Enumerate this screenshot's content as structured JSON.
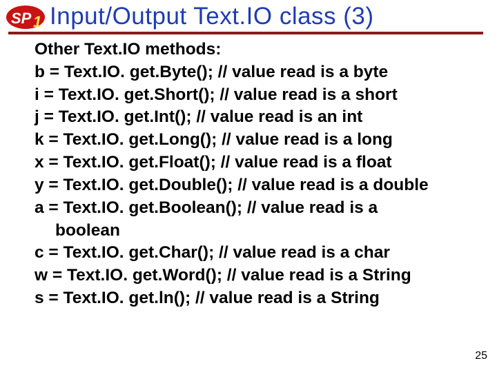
{
  "logo": {
    "text_main": "SP",
    "text_sub": "1"
  },
  "title": "Input/Output Text.IO class (3)",
  "lead": "Other Text.IO  methods:",
  "lines": [
    "b = Text.IO. get.Byte(); // value read is a byte",
    "i = Text.IO. get.Short(); // value read is a short",
    "j = Text.IO. get.Int(); // value read is an int",
    "k = Text.IO. get.Long(); // value read is a long",
    "x = Text.IO. get.Float(); // value read is a float",
    "y = Text.IO. get.Double(); // value read is a double",
    "a = Text.IO. get.Boolean(); // value read is a"
  ],
  "continuation": "boolean",
  "tail": [
    "c = Text.IO. get.Char(); // value read is a char",
    "w = Text.IO. get.Word(); // value read is a String",
    "s = Text.IO. get.ln(); // value read is a String"
  ],
  "page_number": "25"
}
